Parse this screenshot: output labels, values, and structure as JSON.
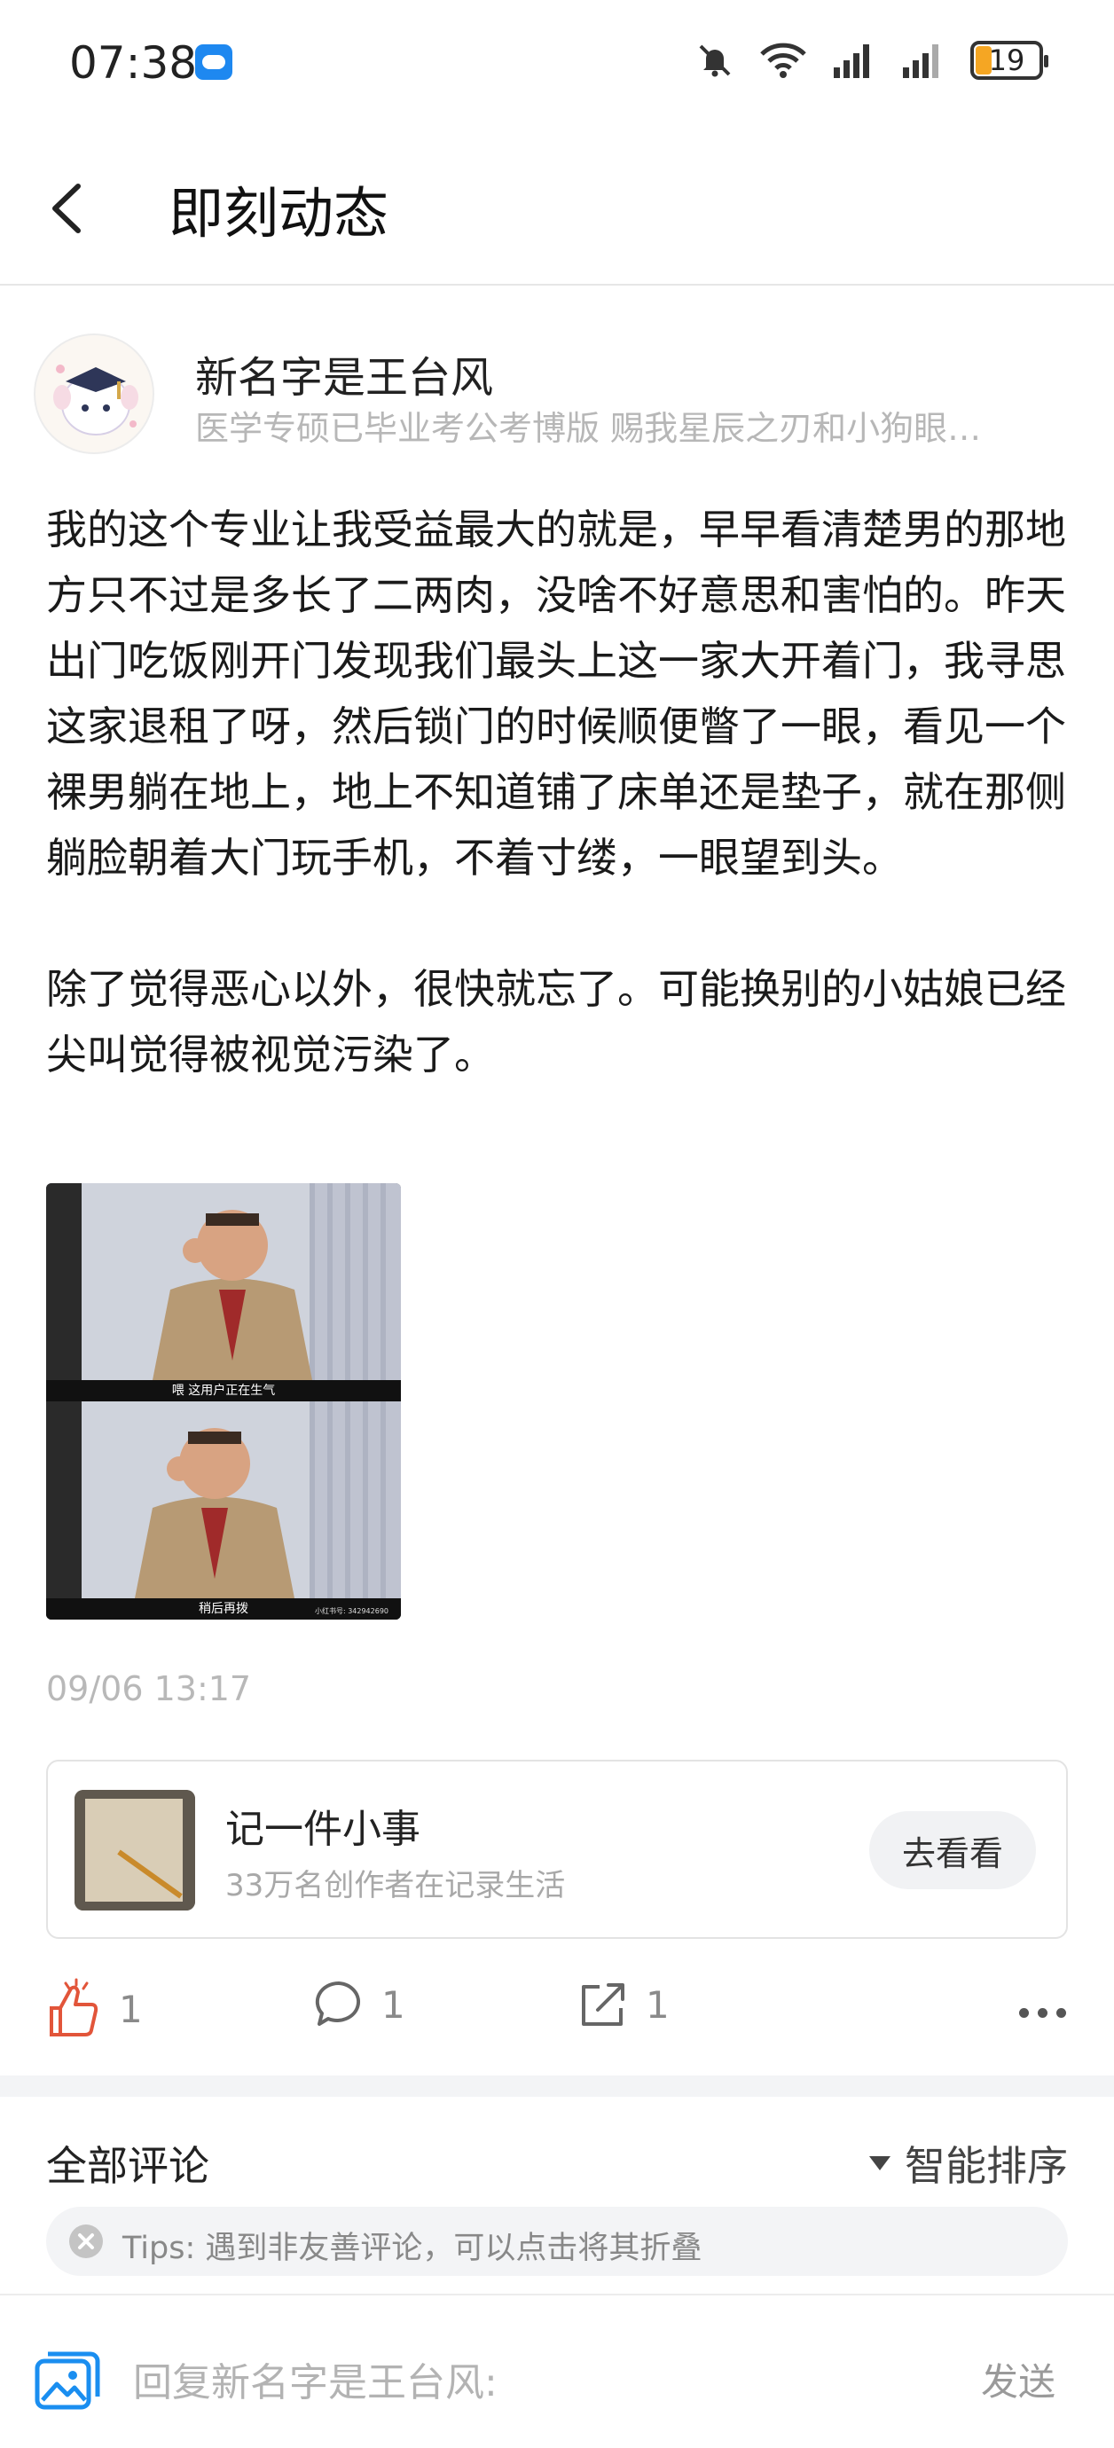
{
  "status_bar": {
    "time": "07:38",
    "battery": "19"
  },
  "header": {
    "title": "即刻动态"
  },
  "author": {
    "name": "新名字是王台风",
    "signature": "医学专硕已毕业考公考博版 赐我星辰之刃和小狗眼…"
  },
  "post": {
    "paragraph_1": "我的这个专业让我受益最大的就是，早早看清楚男的那地方只不过是多长了二两肉，没啥不好意思和害怕的。昨天出门吃饭刚开门发现我们最头上这一家大开着门，我寻思这家退租了呀，然后锁门的时候顺便瞥了一眼，看见一个裸男躺在地上，地上不知道铺了床单还是垫子，就在那侧躺脸朝着大门玩手机，不着寸缕，一眼望到头。",
    "paragraph_2": "除了觉得恶心以外，很快就忘了。可能换别的小姑娘已经尖叫觉得被视觉污染了。",
    "image": {
      "caption_top": "喂  这用户正在生气",
      "caption_bottom": "稍后再拨",
      "watermark": "小红书号: 342942690"
    },
    "timestamp": "09/06 13:17"
  },
  "promo": {
    "title": "记一件小事",
    "subtitle": "33万名创作者在记录生活",
    "button": "去看看"
  },
  "actions": {
    "likes": "1",
    "comments": "1",
    "shares": "1"
  },
  "comments": {
    "title": "全部评论",
    "sort": "智能排序",
    "tips": "Tips: 遇到非友善评论，可以点击将其折叠"
  },
  "reply": {
    "placeholder": "回复新名字是王台风:",
    "send": "发送"
  },
  "colors": {
    "like_accent": "#e2553a",
    "icon_blue": "#1a8ef0"
  }
}
